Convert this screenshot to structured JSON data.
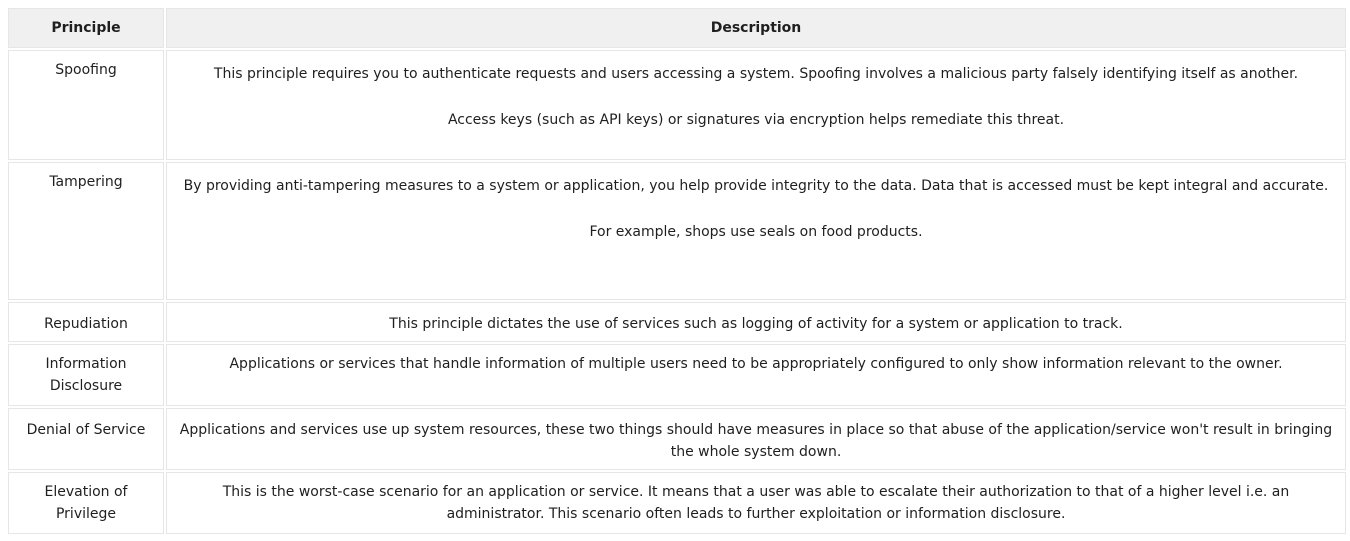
{
  "table": {
    "headers": {
      "principle": "Principle",
      "description": "Description"
    },
    "rows": [
      {
        "principle": "Spoofing",
        "paragraphs": [
          "This principle requires you to authenticate requests and users accessing a system. Spoofing involves a malicious party falsely identifying itself as another.",
          "Access keys (such as API keys) or signatures via encryption helps remediate this threat."
        ]
      },
      {
        "principle": "Tampering",
        "paragraphs": [
          "By providing anti-tampering measures to a system or application, you help provide integrity to the data. Data that is accessed must be kept integral and accurate.",
          "For example, shops use seals on food products."
        ]
      },
      {
        "principle": "Repudiation",
        "paragraphs": [
          "This principle dictates the use of services such as logging of activity for a system or application to track."
        ]
      },
      {
        "principle": "Information Disclosure",
        "paragraphs": [
          "Applications or services that handle information of multiple users need to be appropriately configured to only show information relevant to the owner."
        ]
      },
      {
        "principle": "Denial of Service",
        "paragraphs": [
          "Applications and services use up system resources, these two things should have measures in place so that abuse of the application/service won't result in bringing the whole system down."
        ]
      },
      {
        "principle": "Elevation of Privilege",
        "paragraphs": [
          "This is the worst-case scenario for an application or service. It means that a user was able to escalate their authorization to that of a higher level i.e. an administrator. This scenario often leads to further exploitation or information disclosure."
        ]
      }
    ]
  }
}
